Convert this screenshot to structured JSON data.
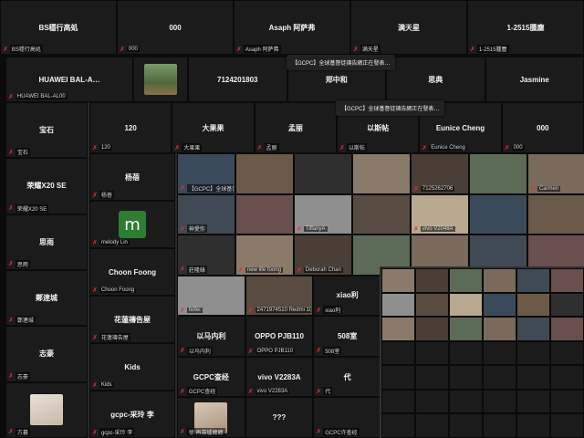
{
  "toasts": [
    "【GCPC】全球基督徒禱告網正在發表…",
    "【GCPC】全球基督徒禱告網正在發表…"
  ],
  "layer1": [
    {
      "name": "BS穩行高処",
      "tag": "BS穩行高処"
    },
    {
      "name": "000",
      "tag": "000"
    },
    {
      "name": "Asaph 阿萨弗",
      "tag": "Asaph 阿萨弗"
    },
    {
      "name": "满天星",
      "tag": "满天星"
    },
    {
      "name": "1-2515腫塵",
      "tag": "1-2515腫塵"
    }
  ],
  "layer2_top": [
    {
      "name": "HUAWEI BAL-A…",
      "tag": "HUAWEI BAL-AL00"
    },
    {
      "name": "",
      "tag": ""
    },
    {
      "name": "7124201803",
      "tag": ""
    },
    {
      "name": "郑中和",
      "tag": ""
    },
    {
      "name": "思典",
      "tag": ""
    },
    {
      "name": "Jasmine",
      "tag": ""
    }
  ],
  "layer2_left": [
    {
      "name": "宝石",
      "tag": "宝石"
    },
    {
      "name": "荣耀X20 SE",
      "tag": "荣耀X20 SE"
    },
    {
      "name": "思雨",
      "tag": "思雨"
    },
    {
      "name": "鄭連城",
      "tag": "鄭連城"
    },
    {
      "name": "志豪",
      "tag": "志豪"
    },
    {
      "name": "",
      "tag": "方暮"
    }
  ],
  "layer3_top": [
    {
      "name": "120",
      "tag": "120"
    },
    {
      "name": "大果果",
      "tag": "大果果"
    },
    {
      "name": "孟丽",
      "tag": "孟丽"
    },
    {
      "name": "以斯帖",
      "tag": "以斯帖"
    },
    {
      "name": "Eunice Cheng",
      "tag": "Eunice Cheng"
    },
    {
      "name": "000",
      "tag": "000"
    }
  ],
  "layer3_left": [
    {
      "name": "杨蓓",
      "tag": "杨蓓"
    },
    {
      "name": "m",
      "tag": "melody Lin"
    },
    {
      "name": "Choon Foong",
      "tag": "Choon Foong"
    },
    {
      "name": "花蓮禱告屋",
      "tag": "花蓮禱告屋"
    },
    {
      "name": "Kids",
      "tag": "Kids"
    },
    {
      "name": "gcpc-采玲 李",
      "tag": "gcpc-采玲 李"
    }
  ],
  "layer4_rows": [
    [
      {
        "name": "",
        "tag": "【GCPC】全球基督徒禱告網"
      },
      {
        "name": "",
        "tag": ""
      },
      {
        "name": "",
        "tag": ""
      },
      {
        "name": "",
        "tag": ""
      },
      {
        "name": "",
        "tag": "7125262706"
      },
      {
        "name": "",
        "tag": ""
      },
      {
        "name": "",
        "tag": "Carmen"
      }
    ],
    [
      {
        "name": "",
        "tag": "神愛你"
      },
      {
        "name": "",
        "tag": ""
      },
      {
        "name": "",
        "tag": "TiffanyA"
      },
      {
        "name": "",
        "tag": ""
      },
      {
        "name": "",
        "tag": "vivo V2048A"
      },
      {
        "name": "",
        "tag": ""
      },
      {
        "name": "",
        "tag": ""
      }
    ],
    [
      {
        "name": "",
        "tag": "莊隆綠"
      },
      {
        "name": "",
        "tag": "new life foong"
      },
      {
        "name": "",
        "tag": "Deborah Chan"
      },
      {
        "name": "",
        "tag": ""
      },
      {
        "name": "",
        "tag": ""
      },
      {
        "name": "",
        "tag": ""
      },
      {
        "name": "",
        "tag": ""
      }
    ],
    [
      {
        "name": "",
        "tag": "feifei"
      },
      {
        "name": "",
        "tag": "2471974510 Redmi 10C 4G"
      },
      {
        "name": "xiao利",
        "tag": "xiao利"
      }
    ],
    [
      {
        "name": "以马内利",
        "tag": "以马内利"
      },
      {
        "name": "OPPO PJB110",
        "tag": "OPPO PJB110"
      },
      {
        "name": "508室",
        "tag": "508室"
      }
    ],
    [
      {
        "name": "GCPC查经",
        "tag": "GCPC查经"
      },
      {
        "name": "vivo V2283A",
        "tag": "vivo V2283A"
      },
      {
        "name": "代",
        "tag": "代"
      }
    ],
    [
      {
        "name": "",
        "tag": "徐 再藻爐嬷嬷"
      },
      {
        "name": "???",
        "tag": ""
      },
      {
        "name": "",
        "tag": "GCPC许查经"
      }
    ]
  ],
  "layer5_rows": [
    [
      "",
      "",
      "",
      "",
      "",
      ""
    ],
    [
      "",
      "",
      "",
      "",
      "",
      ""
    ],
    [
      "",
      "",
      "",
      "",
      "",
      ""
    ],
    [
      "",
      "",
      "",
      "",
      "",
      ""
    ],
    [
      "",
      "",
      "",
      "",
      "",
      ""
    ],
    [
      "",
      "",
      "",
      "",
      "",
      ""
    ],
    [
      "",
      "",
      "",
      "",
      "",
      ""
    ]
  ],
  "colors": {
    "accent_green": "#2e7d32",
    "mic_muted": "#e03131",
    "gcpc_green": "#1f8f4e"
  }
}
